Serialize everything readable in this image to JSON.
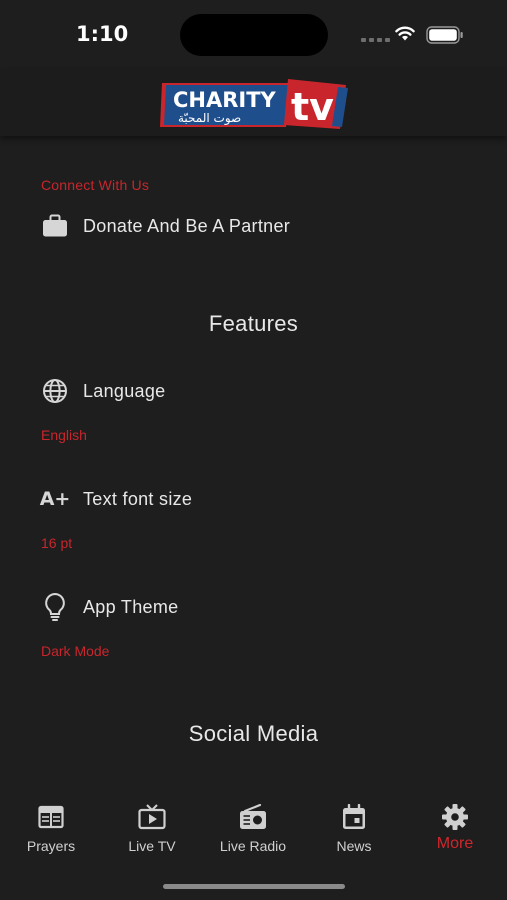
{
  "status_bar": {
    "time": "1:10"
  },
  "header": {
    "logo_text": "CHARITY",
    "logo_tv": "tv",
    "logo_arabic": "صوت المحبّة"
  },
  "connect": {
    "label": "Connect With Us",
    "donate": {
      "label": "Donate And Be A Partner",
      "icon": "briefcase-icon"
    }
  },
  "features": {
    "title": "Features",
    "language": {
      "label": "Language",
      "value": "English",
      "icon": "globe-icon"
    },
    "font_size": {
      "label": "Text font size",
      "value": "16 pt",
      "icon": "text-size-icon",
      "icon_text": "A+"
    },
    "theme": {
      "label": "App Theme",
      "value": "Dark Mode",
      "icon": "lightbulb-icon"
    }
  },
  "social": {
    "title": "Social Media"
  },
  "tabs": [
    {
      "label": "Prayers",
      "icon": "prayers-icon"
    },
    {
      "label": "Live TV",
      "icon": "tv-icon"
    },
    {
      "label": "Live Radio",
      "icon": "radio-icon"
    },
    {
      "label": "News",
      "icon": "calendar-icon"
    },
    {
      "label": "More",
      "icon": "gear-icon",
      "active": true
    }
  ],
  "colors": {
    "accent": "#c8262c",
    "background": "#1e1e1e",
    "logo_blue": "#1f4e8c"
  }
}
